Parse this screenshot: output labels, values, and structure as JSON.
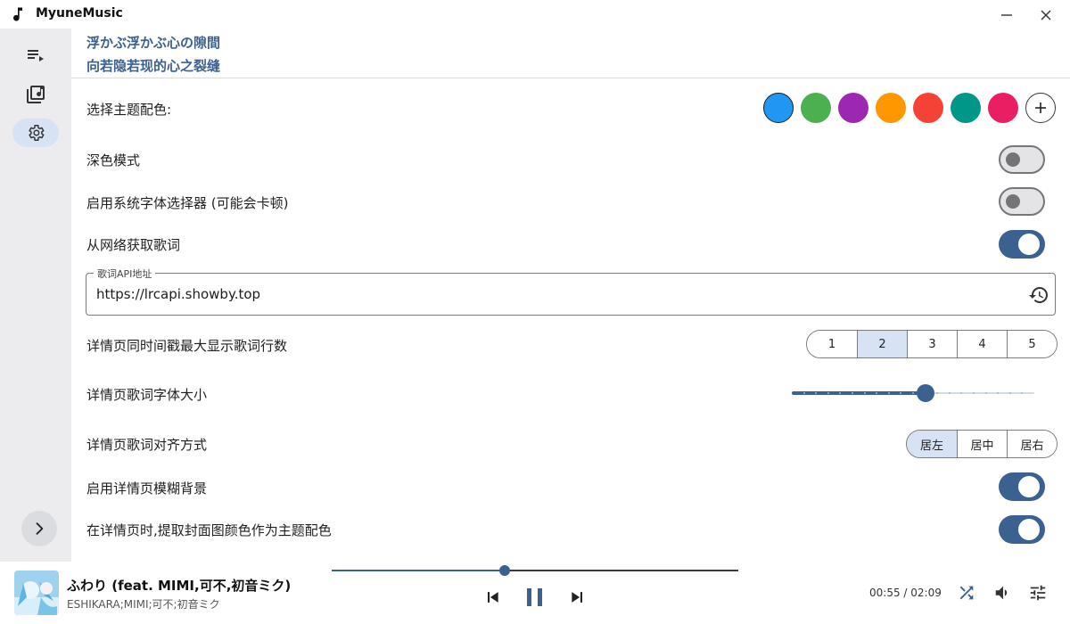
{
  "app": {
    "title": "MyuneMusic"
  },
  "lyrics": {
    "line1": "浮かぶ浮かぶ心の隙間",
    "line2": "向若隐若现的心之裂缝"
  },
  "settings": {
    "theme_color_label": "选择主题配色:",
    "theme_colors": [
      "#2196f3",
      "#4caf50",
      "#9c27b0",
      "#ff9800",
      "#f44336",
      "#009688",
      "#e91e63"
    ],
    "selected_color": "#2196f3",
    "dark_mode_label": "深色模式",
    "dark_mode": false,
    "system_font_label": "启用系统字体选择器 (可能会卡顿)",
    "system_font": false,
    "net_lyrics_label": "从网络获取歌词",
    "net_lyrics": true,
    "api_label": "歌词API地址",
    "api_value": "https://lrcapi.showby.top",
    "max_lines_label": "详情页同时间戳最大显示歌词行数",
    "max_lines_options": [
      "1",
      "2",
      "3",
      "4",
      "5"
    ],
    "max_lines_selected": "2",
    "font_size_label": "详情页歌词字体大小",
    "font_size_fraction": 0.55,
    "font_size_steps": 20,
    "align_label": "详情页歌词对齐方式",
    "align_options": [
      "居左",
      "居中",
      "居右"
    ],
    "align_selected": "居左",
    "blur_bg_label": "启用详情页模糊背景",
    "blur_bg": true,
    "cover_color_label": "在详情页时,提取封面图颜色作为主题配色",
    "cover_color": true
  },
  "player": {
    "title": "ふわり (feat. MIMI,可不,初音ミク)",
    "artist": "ESHIKARA;MIMI;可不;初音ミク",
    "current_time": "00:55",
    "total_time": "02:09",
    "time_display": "00:55 / 02:09",
    "progress": 0.426
  },
  "colors": {
    "accent": "#3a6190",
    "selected_bg": "#d7e3f4"
  },
  "icons": {
    "sidebar": [
      "playlist-icon",
      "music-library-icon",
      "settings-icon",
      "chevron-right-icon"
    ],
    "player": [
      "skip-previous-icon",
      "pause-icon",
      "skip-next-icon",
      "shuffle-icon",
      "volume-icon",
      "equalizer-icon"
    ]
  }
}
